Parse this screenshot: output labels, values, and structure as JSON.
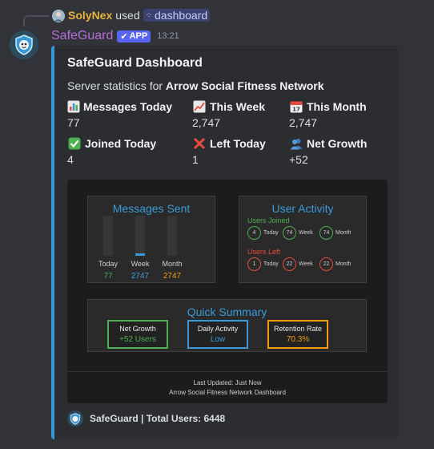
{
  "reply": {
    "username": "SolyNex",
    "used_text": "used",
    "command": "dashboard"
  },
  "message": {
    "bot_name": "SafeGuard",
    "badge": "APP",
    "timestamp": "13:21"
  },
  "embed": {
    "accent_color": "#3498db",
    "title": "SafeGuard Dashboard",
    "description_prefix": "Server statistics for ",
    "server_name": "Arrow Social Fitness Network",
    "fields": [
      {
        "icon": "bar-chart-icon",
        "name": "Messages Today",
        "value": "77"
      },
      {
        "icon": "chart-increasing-icon",
        "name": "This Week",
        "value": "2,747"
      },
      {
        "icon": "calendar-icon",
        "name": "This Month",
        "value": "2,747"
      },
      {
        "icon": "check-mark-icon",
        "name": "Joined Today",
        "value": "4"
      },
      {
        "icon": "cross-mark-icon",
        "name": "Left Today",
        "value": "1"
      },
      {
        "icon": "people-icon",
        "name": "Net Growth",
        "value": "+52"
      }
    ],
    "footer": "SafeGuard | Total Users: 6448"
  },
  "dashboard_image": {
    "messages_sent": {
      "title": "Messages Sent",
      "bars": [
        {
          "label": "Today",
          "value": "77",
          "fill": 0.0,
          "color": "#4caf50"
        },
        {
          "label": "Week",
          "value": "2747",
          "fill": 0.05,
          "color": "#3a9ad9"
        },
        {
          "label": "Month",
          "value": "2747",
          "fill": 0.0,
          "color": "#f39c12"
        }
      ]
    },
    "user_activity": {
      "title": "User Activity",
      "joined_label": "Users Joined",
      "left_label": "Users Left",
      "joined": [
        {
          "value": "4",
          "label": "Today"
        },
        {
          "value": "74",
          "label": "Week"
        },
        {
          "value": "74",
          "label": "Month"
        }
      ],
      "left": [
        {
          "value": "1",
          "label": "Today"
        },
        {
          "value": "22",
          "label": "Week"
        },
        {
          "value": "22",
          "label": "Month"
        }
      ],
      "joined_color": "#4caf50",
      "left_color": "#e74c3c"
    },
    "quick_summary": {
      "title": "Quick Summary",
      "boxes": [
        {
          "title": "Net Growth",
          "value": "+52 Users",
          "color": "#4caf50"
        },
        {
          "title": "Daily Activity",
          "value": "Low",
          "color": "#3a9ad9"
        },
        {
          "title": "Retention Rate",
          "value": "70.3%",
          "color": "#f39c12"
        }
      ]
    },
    "footer_line1": "Last Updated: Just Now",
    "footer_line2": "Arrow Social Fitness Network Dashboard"
  }
}
